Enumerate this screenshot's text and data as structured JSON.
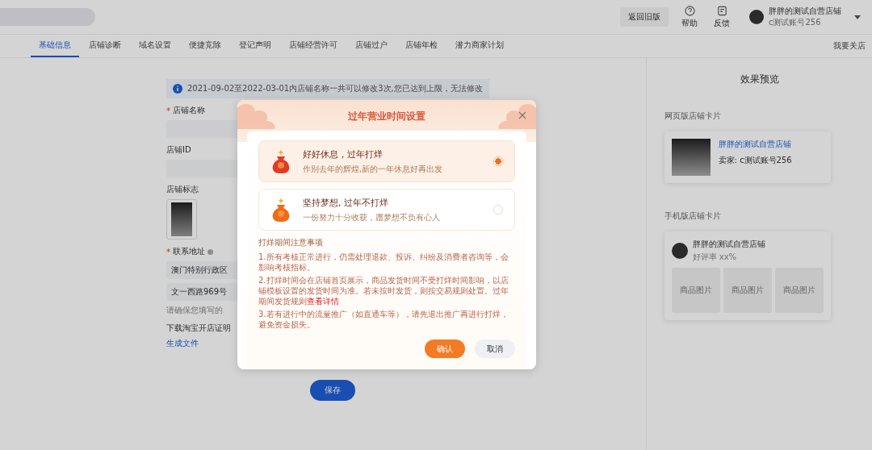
{
  "header": {
    "back_button": "返回旧版",
    "actions": [
      {
        "kind": "help",
        "label": "帮助"
      },
      {
        "kind": "feedback",
        "label": "反馈"
      }
    ],
    "account": {
      "name": "胖胖的测试自营店铺",
      "sub": "c测试账号256"
    }
  },
  "tabs": [
    {
      "label": "基础信息",
      "selected": true
    },
    {
      "label": "店铺诊断",
      "selected": false
    },
    {
      "label": "域名设置",
      "selected": false
    },
    {
      "label": "便捷竞除",
      "selected": false
    },
    {
      "label": "登记声明",
      "selected": false
    },
    {
      "label": "店铺经营许可",
      "selected": false
    },
    {
      "label": "店铺过户",
      "selected": false
    },
    {
      "label": "店铺年检",
      "selected": false
    },
    {
      "label": "潜力商家计划",
      "selected": false
    }
  ],
  "tabs_right_link": "我要关店",
  "form": {
    "notice": "2021-09-02至2022-03-01内店铺名称一共可以修改3次,您已达到上限，无法修改",
    "fields": [
      {
        "kind": "input",
        "label": "店铺名称",
        "mark": "*"
      },
      {
        "kind": "input",
        "label": "店铺ID"
      },
      {
        "kind": "logo",
        "label": "店铺标志"
      },
      {
        "kind": "address",
        "label": "联系地址",
        "mark": "*",
        "help": true,
        "values": [
          "澳门特别行政区",
          "文一西路969号"
        ],
        "hint": "请确保您填写的"
      },
      {
        "kind": "link",
        "label": "下载淘宝开店证明",
        "link": "生成文件"
      }
    ],
    "save_button": "保存"
  },
  "preview": {
    "title": "效果预览",
    "web_card": {
      "label": "网页版店铺卡片",
      "name": "胖胖的测试自营店铺",
      "seller": "卖家: c测试账号256"
    },
    "mobile_card": {
      "label": "手机版店铺卡片",
      "name": "胖胖的测试自营店铺",
      "rating": "好评率 xx%",
      "thumbnails": [
        "商品图片",
        "商品图片",
        "商品图片"
      ]
    }
  },
  "dialog": {
    "title": "过年营业时间设置",
    "options": [
      {
        "title": "好好休息，过年打烊",
        "desc": "作别去年的辉煌,新的一年休息好再出发",
        "selected": true
      },
      {
        "title": "坚持梦想, 过年不打烊",
        "desc": "一份努力十分收获，愿梦想不负有心人",
        "selected": false
      }
    ],
    "notes_title": "打烊期间注意事项",
    "notes": [
      {
        "text": "1.所有考核正常进行，仍需处理退款、投诉、纠纷及消费者咨询等，会影响考核指标。"
      },
      {
        "text": "2.打烊时间会在店铺首页展示，商品发货时间不受打烊时间影响，以店铺模板设置的发货时间为准。若未按时发货，则按交易规则处置。过年期间发货规则",
        "link": "查看详情"
      },
      {
        "text": "3.若有进行中的流量推广（如直通车等），请先退出推广再进行打烊，避免资金损失。"
      }
    ],
    "confirm": "确认",
    "cancel": "取消"
  }
}
